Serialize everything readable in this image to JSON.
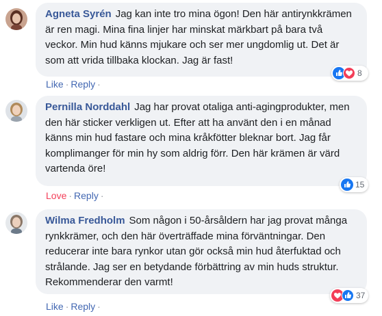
{
  "comments": [
    {
      "author": "Agneta Syrén",
      "text": "Jag kan inte tro mina ögon! Den här antirynkkrämen är ren magi. Mina fina linjer har minskat märkbart på bara två veckor. Min hud känns mjukare och ser mer ungdomlig ut. Det är som att vrida tillbaka klockan. Jag är fast!",
      "actions": {
        "first": "Like",
        "second": "Reply"
      },
      "reactions": {
        "icons": [
          "like-icon",
          "love-icon"
        ],
        "count": "8"
      }
    },
    {
      "author": "Pernilla Norddahl",
      "text": "Jag har provat otaliga anti-agingprodukter, men den här sticker verkligen ut. Efter att ha använt den i en månad känns min hud fastare och mina kråkfötter bleknar bort. Jag får komplimanger för min hy som aldrig förr. Den här krämen är värd vartenda öre!",
      "actions": {
        "first": "Love",
        "second": "Reply"
      },
      "reactions": {
        "icons": [
          "like-icon"
        ],
        "count": "15"
      }
    },
    {
      "author": "Wilma Fredholm",
      "text": "Som någon i 50-årsåldern har jag provat många rynkkrämer, och den här överträffade mina förväntningar. Den reducerar inte bara rynkor utan gör också min hud återfuktad och strålande. Jag ser en betydande förbättring av min huds struktur. Rekommenderar den varmt!",
      "actions": {
        "first": "Like",
        "second": "Reply"
      },
      "reactions": {
        "icons": [
          "love-icon",
          "like-icon"
        ],
        "count": "37"
      }
    }
  ],
  "colors": {
    "link": "#4267b2",
    "name": "#385898",
    "love": "#f33e58",
    "bubble": "#f0f2f5"
  }
}
